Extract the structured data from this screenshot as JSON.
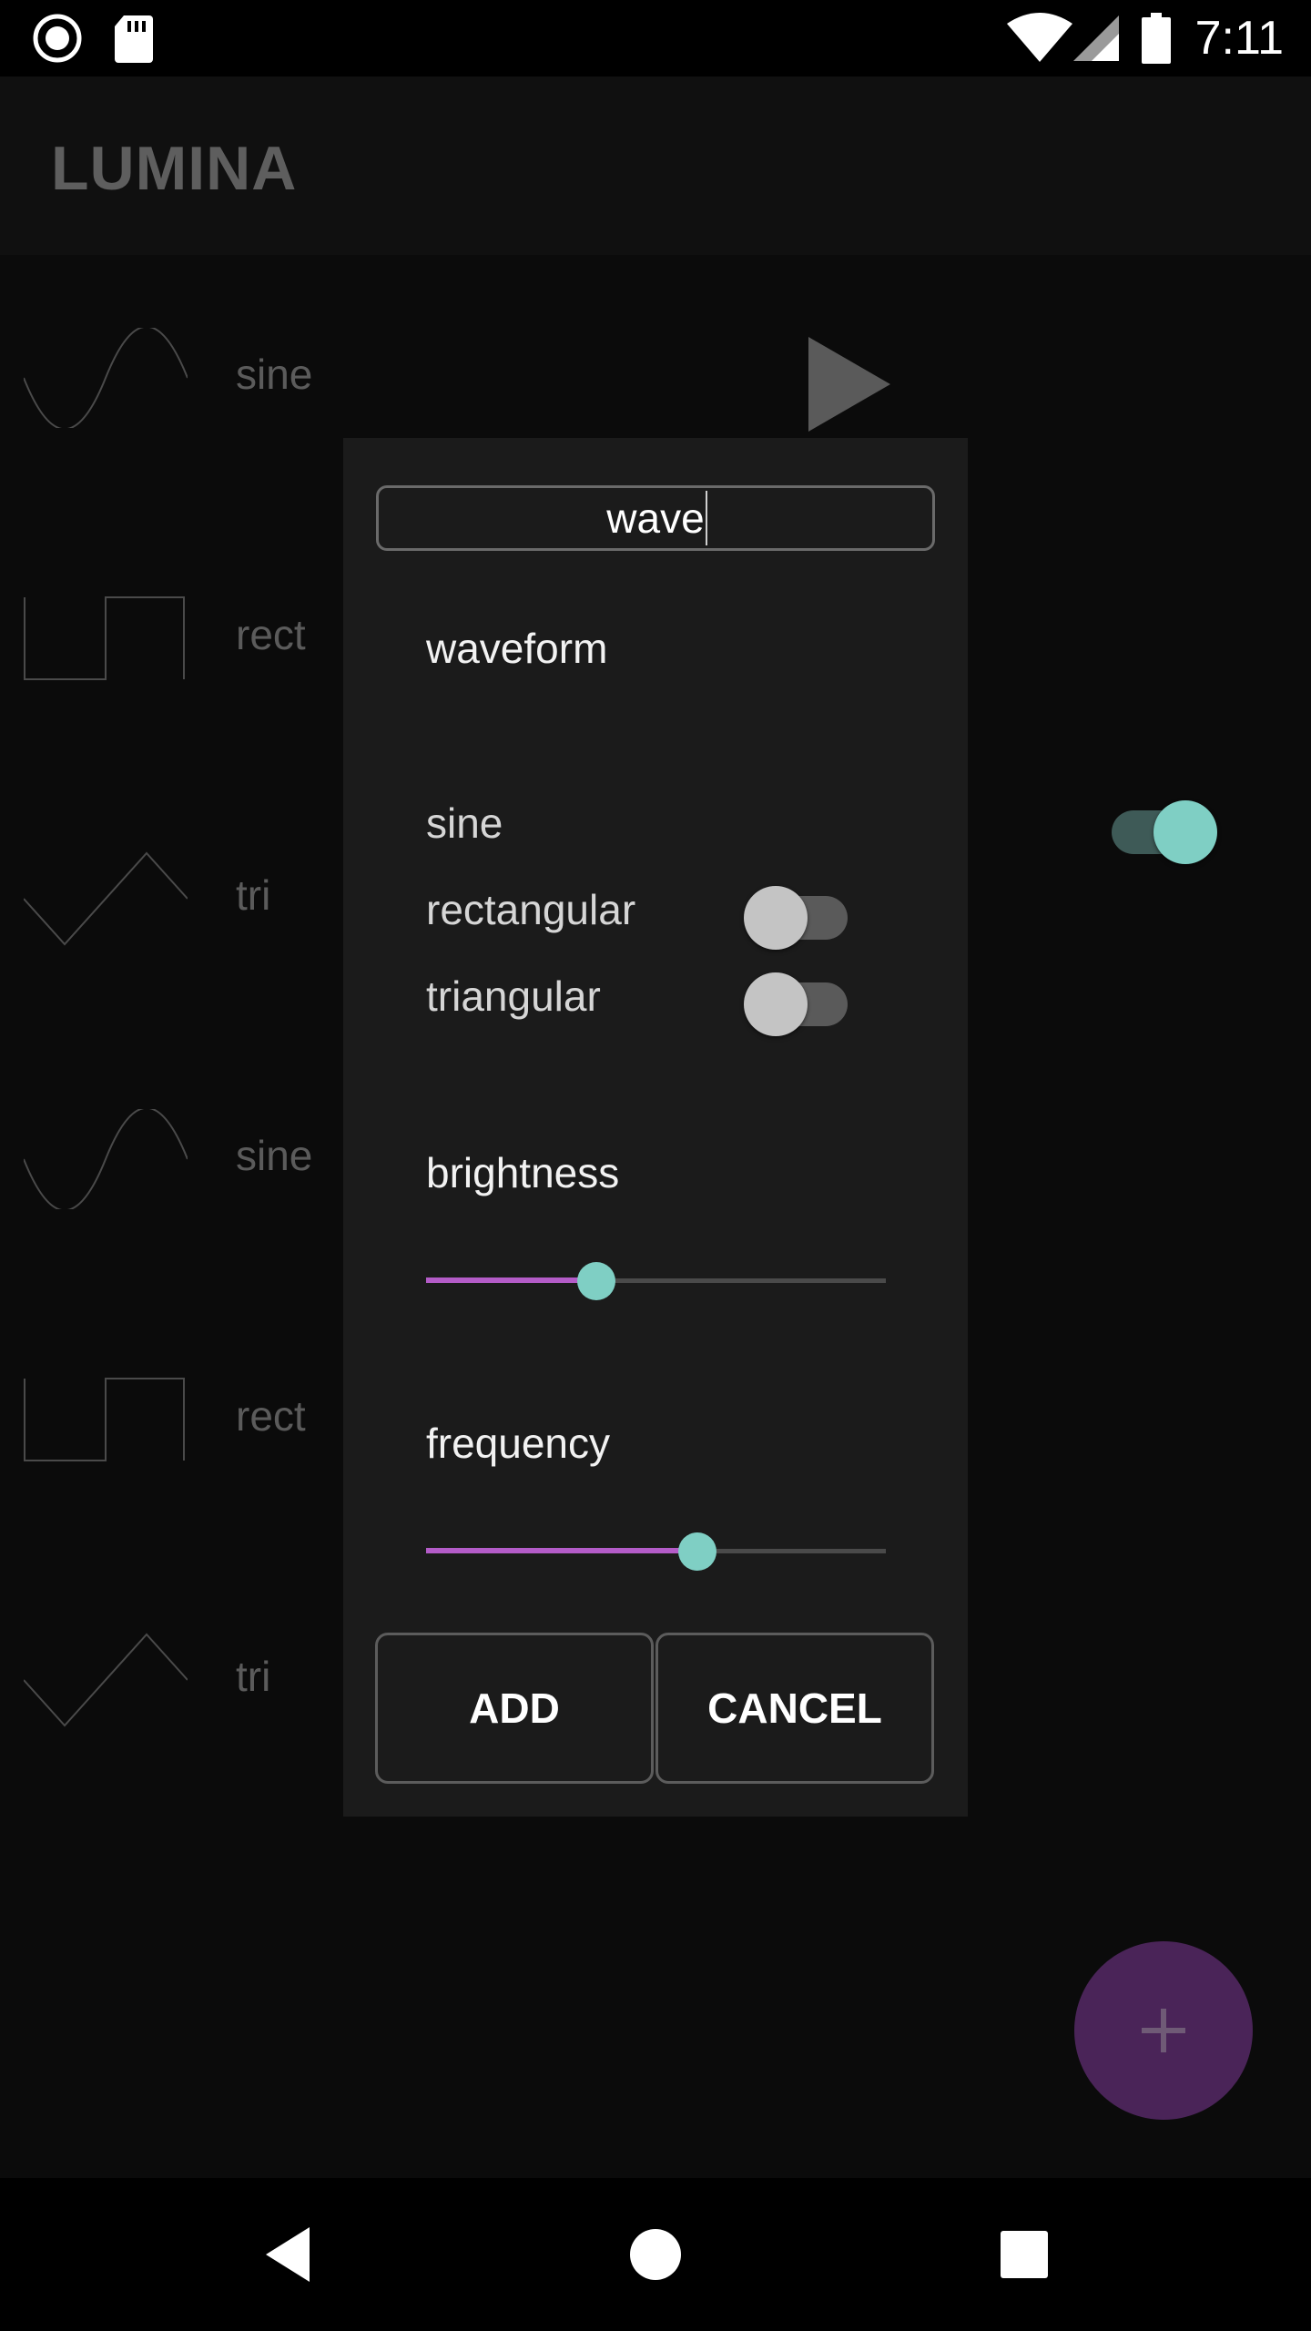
{
  "status_bar": {
    "time": "7:11",
    "icons": [
      "record-icon",
      "sd-card-icon",
      "wifi-icon",
      "signal-icon",
      "battery-icon"
    ]
  },
  "app_bar": {
    "title": "LUMINA"
  },
  "list": {
    "items": [
      {
        "label": "sine",
        "waveform": "sine-wave-icon"
      },
      {
        "label": "rect",
        "waveform": "rect-wave-icon"
      },
      {
        "label": "tri",
        "waveform": "triangle-wave-icon"
      },
      {
        "label": "sine",
        "waveform": "sine-wave-icon"
      },
      {
        "label": "rect",
        "waveform": "rect-wave-icon"
      },
      {
        "label": "tri",
        "waveform": "triangle-wave-icon"
      }
    ],
    "play_icon": "play-icon"
  },
  "dialog": {
    "name_value": "wave",
    "waveform_title": "waveform",
    "options": [
      {
        "label": "sine",
        "on": true
      },
      {
        "label": "rectangular",
        "on": false
      },
      {
        "label": "triangular",
        "on": false
      }
    ],
    "brightness_title": "brightness",
    "brightness_value": 0.37,
    "frequency_title": "frequency",
    "frequency_value": 0.59,
    "add_label": "ADD",
    "cancel_label": "CANCEL"
  },
  "fab": {
    "icon": "plus-icon"
  },
  "colors": {
    "accent": "#b45cc8",
    "teal": "#7fcfc4",
    "fab": "#4a2458",
    "dialog_bg": "#1b1b1b"
  },
  "nav_bar": {
    "icons": [
      "back-icon",
      "home-icon",
      "recents-icon"
    ]
  }
}
